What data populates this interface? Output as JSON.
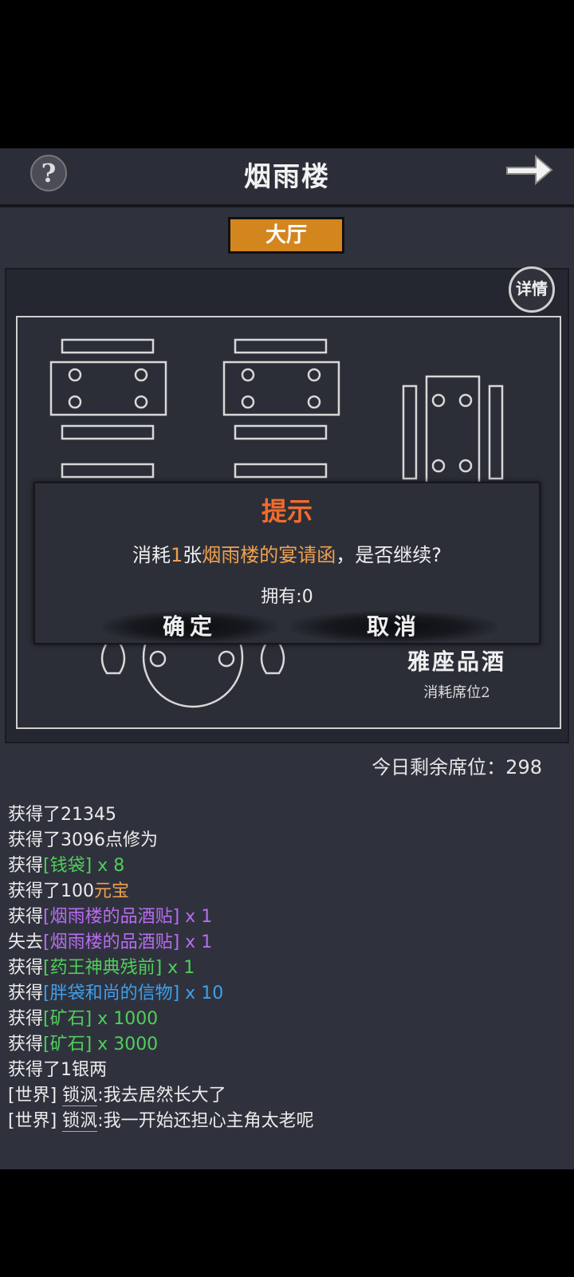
{
  "header": {
    "title": "烟雨楼",
    "help_label": "?"
  },
  "tab": {
    "label": "大厅"
  },
  "panel": {
    "details_label": "详情",
    "yazuo_name": "雅座品酒",
    "yazuo_sub": "消耗席位2",
    "seats_text": "今日剩余席位：298"
  },
  "dialog": {
    "title": "提示",
    "msg_pre": "消耗",
    "msg_num": "1",
    "msg_mid": "张",
    "msg_item": "烟雨楼的宴请函",
    "msg_post": "，是否继续?",
    "owned": "拥有:0",
    "confirm": "确定",
    "cancel": "取消"
  },
  "log": [
    {
      "pre": "获得了21345",
      "item": "",
      "post": "",
      "color": ""
    },
    {
      "pre": "获得了3096点修为",
      "item": "",
      "post": "",
      "color": ""
    },
    {
      "pre": "获得",
      "item": "[钱袋]",
      "post": " x 8",
      "color": "g"
    },
    {
      "pre": "获得了100",
      "item": "元宝",
      "post": "",
      "color": "o"
    },
    {
      "pre": "获得",
      "item": "[烟雨楼的品酒贴]",
      "post": " x 1",
      "color": "p"
    },
    {
      "pre": "失去",
      "item": "[烟雨楼的品酒贴]",
      "post": " x 1",
      "color": "p"
    },
    {
      "pre": "获得",
      "item": "[药王神典残前]",
      "post": " x 1",
      "color": "g"
    },
    {
      "pre": "获得",
      "item": "[胖袋和尚的信物]",
      "post": " x 10",
      "color": "b"
    },
    {
      "pre": "获得",
      "item": "[矿石]",
      "post": " x 1000",
      "color": "g"
    },
    {
      "pre": "获得",
      "item": "[矿石]",
      "post": " x 3000",
      "color": "g"
    },
    {
      "pre": "获得了1银两",
      "item": "",
      "post": "",
      "color": ""
    },
    {
      "pre": "[世界] ",
      "user": "锁沨",
      "post": ":我去居然长大了",
      "color": ""
    },
    {
      "pre": "[世界] ",
      "user": "锁沨",
      "post": ":我一开始还担心主角太老呢",
      "color": ""
    }
  ]
}
